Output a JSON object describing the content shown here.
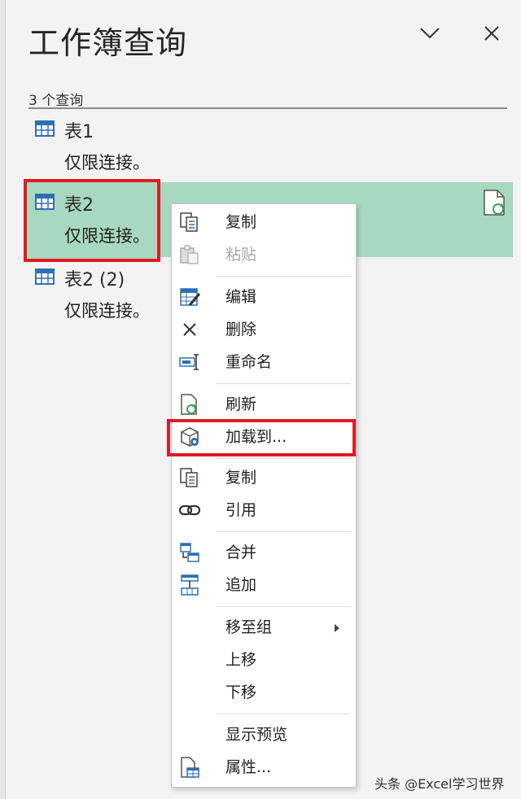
{
  "pane": {
    "title": "工作簿查询",
    "query_count": "3 个查询",
    "queries": [
      {
        "name": "表1",
        "status": "仅限连接。"
      },
      {
        "name": "表2",
        "status": "仅限连接。"
      },
      {
        "name": "表2 (2)",
        "status": "仅限连接。"
      }
    ]
  },
  "context_menu": {
    "items": [
      {
        "label": "复制",
        "icon": "copy-icon",
        "enabled": true
      },
      {
        "label": "粘贴",
        "icon": "paste-icon",
        "enabled": false
      },
      {
        "label": "编辑",
        "icon": "edit-table-icon",
        "enabled": true
      },
      {
        "label": "删除",
        "icon": "delete-x-icon",
        "enabled": true
      },
      {
        "label": "重命名",
        "icon": "rename-icon",
        "enabled": true
      },
      {
        "label": "刷新",
        "icon": "refresh-icon",
        "enabled": true
      },
      {
        "label": "加载到...",
        "icon": "load-to-icon",
        "enabled": true
      },
      {
        "label": "复制",
        "icon": "duplicate-icon",
        "enabled": true
      },
      {
        "label": "引用",
        "icon": "reference-link-icon",
        "enabled": true
      },
      {
        "label": "合并",
        "icon": "merge-icon",
        "enabled": true
      },
      {
        "label": "追加",
        "icon": "append-icon",
        "enabled": true
      },
      {
        "label": "移至组",
        "icon": "",
        "enabled": true,
        "submenu": true
      },
      {
        "label": "上移",
        "icon": "",
        "enabled": true
      },
      {
        "label": "下移",
        "icon": "",
        "enabled": true
      },
      {
        "label": "显示预览",
        "icon": "",
        "enabled": true
      },
      {
        "label": "属性...",
        "icon": "properties-icon",
        "enabled": true
      }
    ]
  },
  "colors": {
    "selection": "#a8d8bf",
    "highlight_border": "#e01b24",
    "icon_blue": "#2f6fb5"
  },
  "watermark": "头条 @Excel学习世界"
}
